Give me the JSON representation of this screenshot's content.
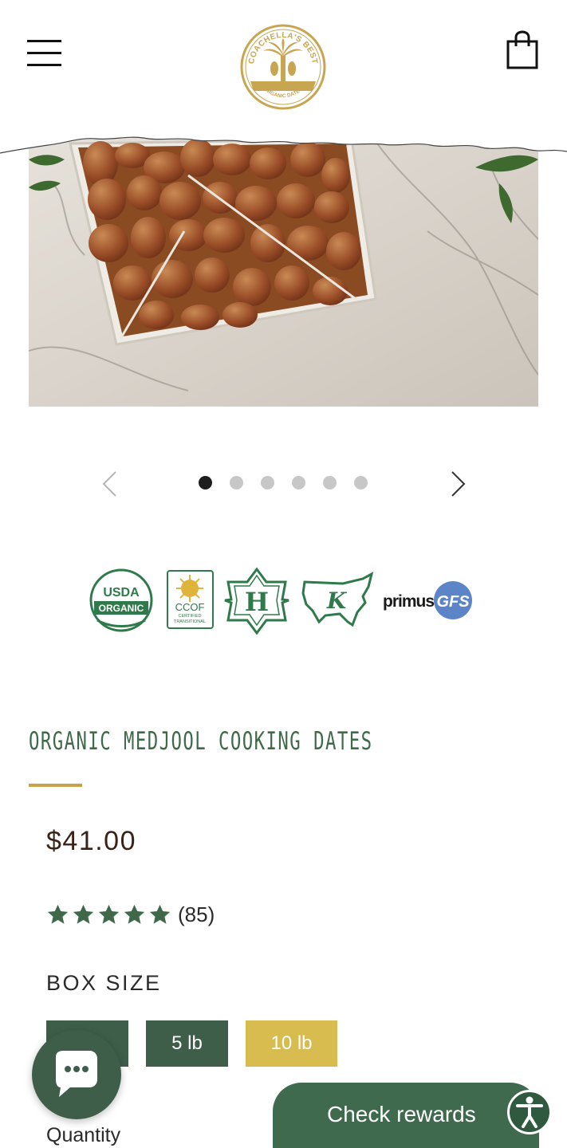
{
  "header": {
    "menu_icon": "hamburger-menu-icon",
    "logo_text_top": "COACHELLA'S BEST",
    "logo_text_bottom": "ORGANIC DATES",
    "cart_icon": "shopping-bag-icon"
  },
  "carousel": {
    "slides": 6,
    "active_index": 0,
    "prev_icon": "chevron-left-icon",
    "next_icon": "chevron-right-icon"
  },
  "badges": {
    "usda_line1": "USDA",
    "usda_line2": "ORGANIC",
    "ccof_name": "CCOF",
    "ccof_line1": "CERTIFIED",
    "ccof_line2": "TRANSITIONAL",
    "halal_letter": "H",
    "kosher_letter": "K",
    "primus_word": "primus",
    "primus_gfs": "GFS"
  },
  "product": {
    "title": "ORGANIC MEDJOOL COOKING DATES",
    "price": "$41.00",
    "rating_value": 5,
    "rating_count": "(85)",
    "box_size_label": "BOX SIZE",
    "sizes": [
      "",
      "5 lb",
      "10 lb"
    ],
    "selected_size": "10 lb",
    "quantity_label": "Quantity"
  },
  "widgets": {
    "chat_icon": "chat-bubble-icon",
    "rewards_label": "Check rewards",
    "accessibility_icon": "accessibility-icon"
  },
  "colors": {
    "brand_green": "#3e5e4a",
    "title_green": "#3f6a4a",
    "gold": "#c7a44a",
    "selected_yellow": "#d8bc4f"
  }
}
